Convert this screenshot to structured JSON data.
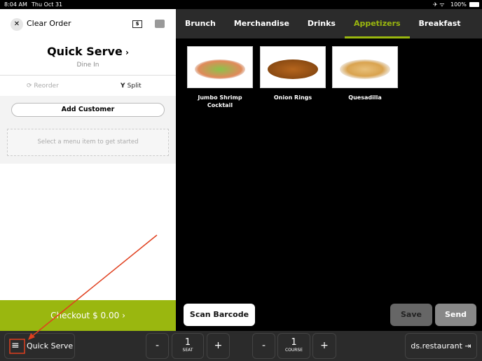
{
  "status": {
    "time": "8:04 AM",
    "date": "Thu Oct 31",
    "battery": "100%"
  },
  "order": {
    "clear_label": "Clear Order",
    "title": "Quick Serve",
    "subtitle": "Dine In",
    "reorder": "Reorder",
    "split": "Split",
    "add_customer": "Add Customer",
    "empty_hint": "Select a menu item to get started",
    "checkout": "Checkout $ 0.00"
  },
  "tabs": [
    {
      "label": "Brunch"
    },
    {
      "label": "Merchandise"
    },
    {
      "label": "Drinks"
    },
    {
      "label": "Appetizers",
      "active": true
    },
    {
      "label": "Breakfast"
    }
  ],
  "items": [
    {
      "label": "Jumbo Shrimp Cocktail"
    },
    {
      "label": "Onion Rings"
    },
    {
      "label": "Quesadilla"
    }
  ],
  "actions": {
    "scan": "Scan Barcode",
    "save": "Save",
    "send": "Send"
  },
  "bottom": {
    "menu_label": "Quick Serve",
    "seat_value": "1",
    "seat_label": "SEAT",
    "course_value": "1",
    "course_label": "COURSE",
    "minus": "-",
    "plus": "+",
    "user": "ds.restaurant"
  },
  "colors": {
    "accent": "#9ab70f",
    "annotation": "#e0401f"
  }
}
